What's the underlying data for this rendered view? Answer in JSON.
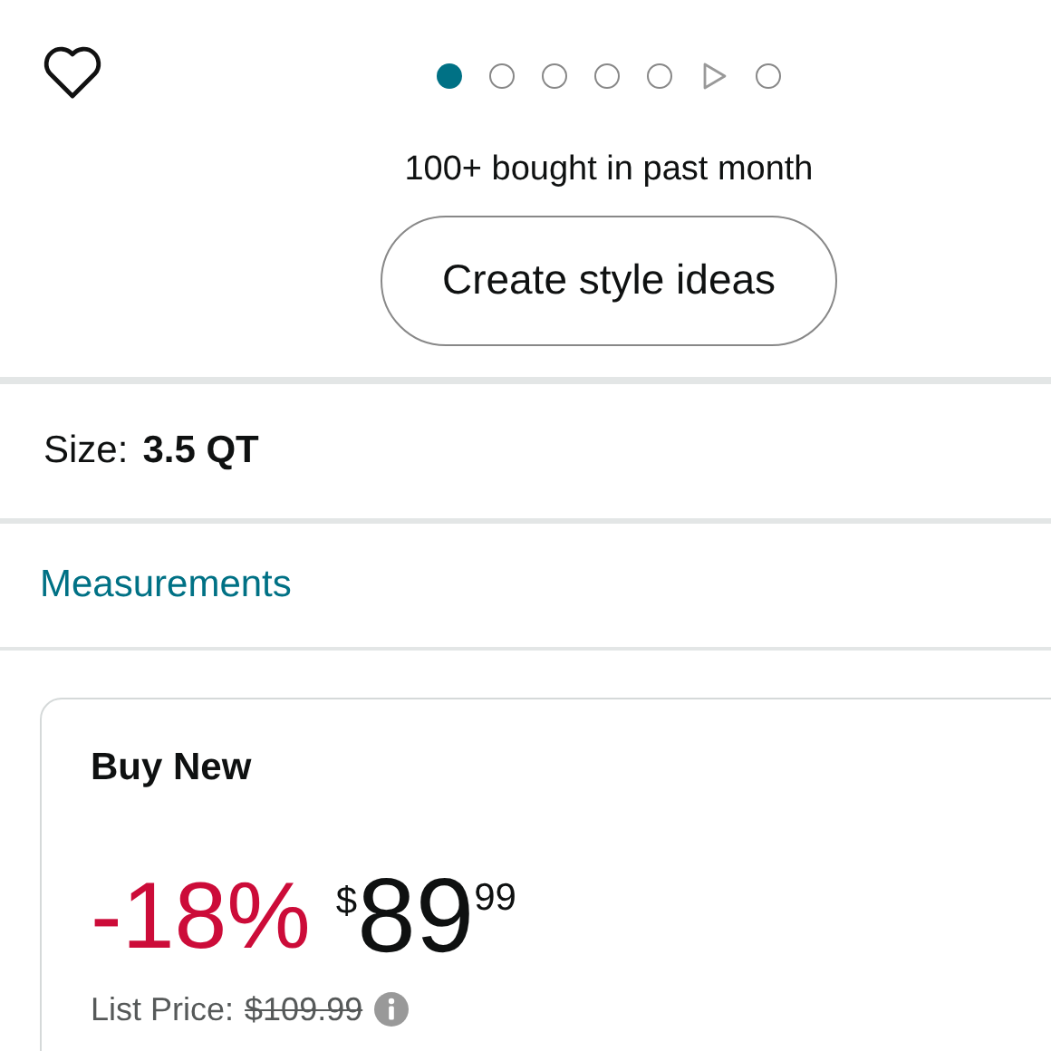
{
  "carousel": {
    "indicators": [
      {
        "kind": "dot",
        "selected": true
      },
      {
        "kind": "dot",
        "selected": false
      },
      {
        "kind": "dot",
        "selected": false
      },
      {
        "kind": "dot",
        "selected": false
      },
      {
        "kind": "dot",
        "selected": false
      },
      {
        "kind": "video",
        "selected": false
      },
      {
        "kind": "dot",
        "selected": false
      }
    ]
  },
  "bought_text": "100+ bought in past month",
  "style_button": "Create style ideas",
  "size": {
    "label": "Size:",
    "value": "3.5 QT"
  },
  "measurements_link": "Measurements",
  "buy_box": {
    "title": "Buy New",
    "discount": "-18%",
    "currency": "$",
    "price_whole": "89",
    "price_fraction": "99",
    "list_price_label": "List Price:",
    "list_price": "$109.99"
  }
}
